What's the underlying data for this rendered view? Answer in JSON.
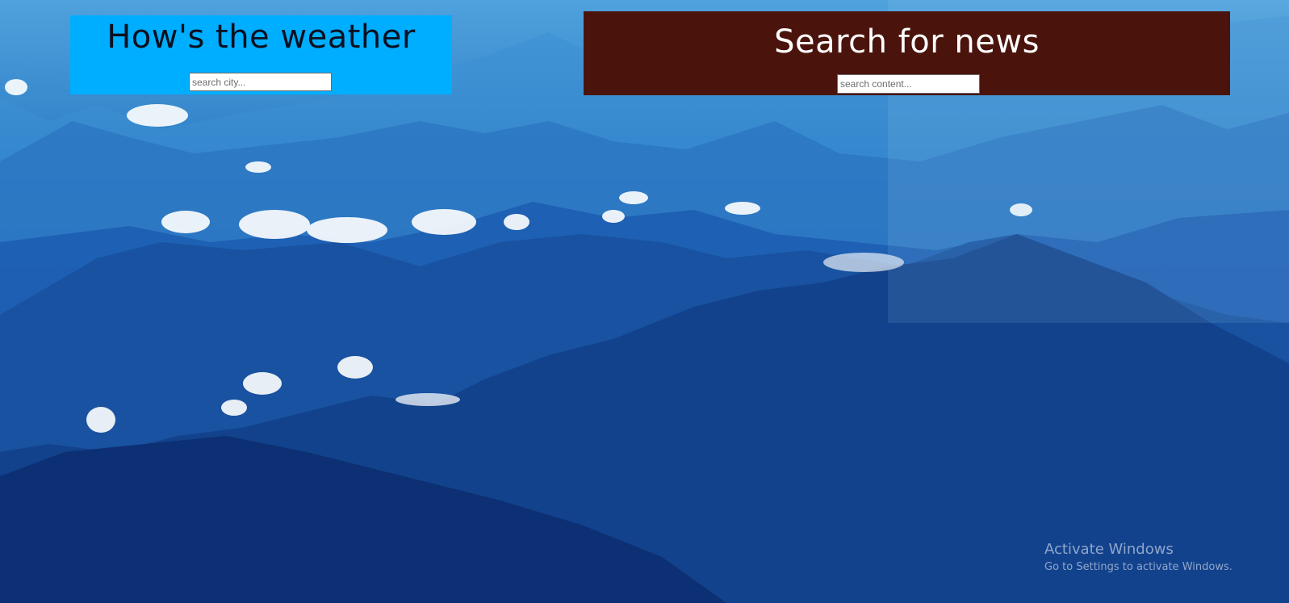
{
  "weather": {
    "title": "How's the weather",
    "search_placeholder": "search city...",
    "panel_color": "#00aeff"
  },
  "news": {
    "title": "Search for news",
    "search_placeholder": "search content...",
    "panel_color": "#4a140d"
  },
  "watermark": {
    "title": "Activate Windows",
    "subtitle": "Go to Settings to activate Windows."
  },
  "background": {
    "description_icon": "mountain-landscape"
  }
}
